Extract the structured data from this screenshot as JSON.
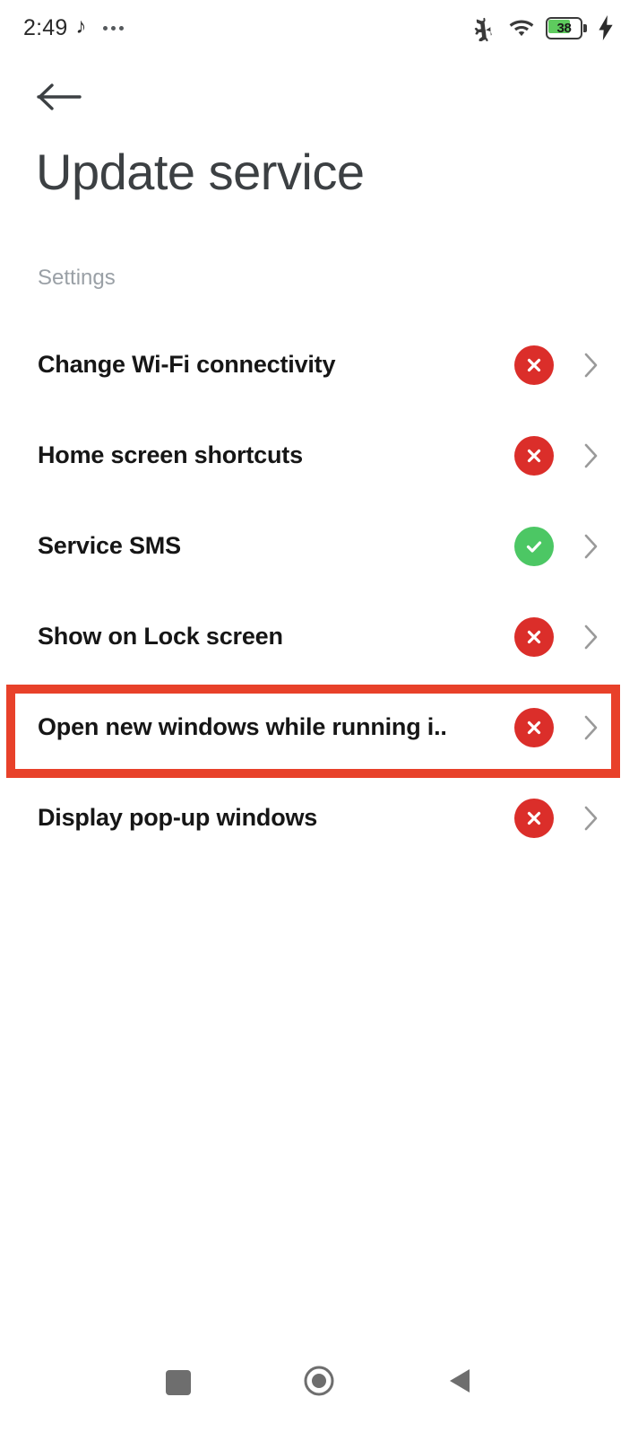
{
  "status_bar": {
    "time": "2:49",
    "music_glyph": "♪",
    "icons": [
      "airplane-mode-icon",
      "wifi-icon",
      "battery-icon",
      "charging-bolt-icon"
    ],
    "battery_percent": "38",
    "battery_fill_color": "#5ecb5e"
  },
  "header": {
    "back_icon": "arrow-left-icon",
    "title": "Update service"
  },
  "section": {
    "label": "Settings"
  },
  "colors": {
    "badge_off": "#db2e2a",
    "badge_on": "#4cc764",
    "highlight": "#e8412a",
    "chevron": "#9a9a9a"
  },
  "settings_items": [
    {
      "label": "Change Wi-Fi connectivity",
      "state": "off",
      "badge_icon": "close-circle-icon",
      "chevron_icon": "chevron-right-icon"
    },
    {
      "label": "Home screen shortcuts",
      "state": "off",
      "badge_icon": "close-circle-icon",
      "chevron_icon": "chevron-right-icon"
    },
    {
      "label": "Service SMS",
      "state": "on",
      "badge_icon": "check-circle-icon",
      "chevron_icon": "chevron-right-icon"
    },
    {
      "label": "Show on Lock screen",
      "state": "off",
      "badge_icon": "close-circle-icon",
      "chevron_icon": "chevron-right-icon"
    },
    {
      "label": "Open new windows while running i..",
      "state": "off",
      "badge_icon": "close-circle-icon",
      "chevron_icon": "chevron-right-icon",
      "highlighted": true
    },
    {
      "label": "Display pop-up windows",
      "state": "off",
      "badge_icon": "close-circle-icon",
      "chevron_icon": "chevron-right-icon"
    }
  ],
  "nav_bar": {
    "recents_icon": "square-icon",
    "home_icon": "circle-icon",
    "back_icon": "triangle-left-icon"
  }
}
